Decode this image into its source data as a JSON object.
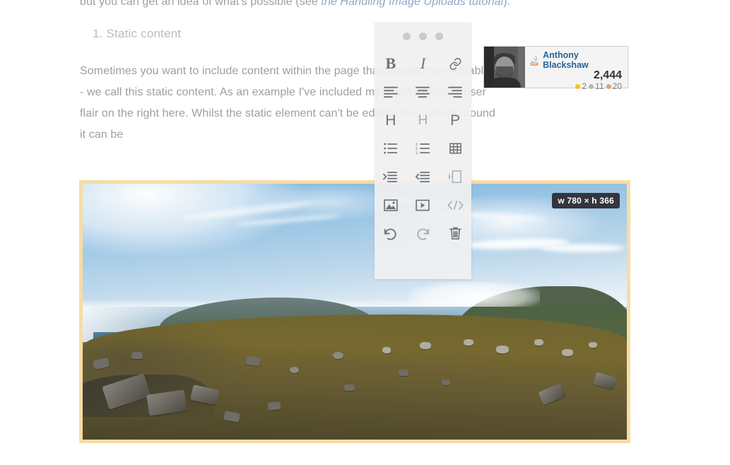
{
  "article": {
    "lead_line_prefix": "but you can get an idea of what's possible (see ",
    "lead_line_link": "the Handling Image Uploads tutorial",
    "lead_line_suffix": ").",
    "heading": "1. Static content",
    "paragraph_part1": "Sometimes you want to include content within the page that shouldn't be editable - we call this static content. As an example I've included my ",
    "paragraph_italic": "Stack Overflow",
    "paragraph_part2": " user flair on the right here. Whilst the static element can't be edited, the content around it can be",
    "trailing_dot": "."
  },
  "toolbar": {
    "drag_handle_dots": 3,
    "buttons": [
      {
        "name": "bold",
        "label": "B"
      },
      {
        "name": "italic",
        "label": "I"
      },
      {
        "name": "link",
        "label": "link"
      },
      {
        "name": "align-left",
        "label": "align left"
      },
      {
        "name": "align-center",
        "label": "align center"
      },
      {
        "name": "align-right",
        "label": "align right"
      },
      {
        "name": "heading-1",
        "label": "H"
      },
      {
        "name": "heading-2",
        "label": "H"
      },
      {
        "name": "paragraph",
        "label": "P"
      },
      {
        "name": "bullet-list",
        "label": "bullet list"
      },
      {
        "name": "numbered-list",
        "label": "numbered list"
      },
      {
        "name": "table",
        "label": "table"
      },
      {
        "name": "indent",
        "label": "indent"
      },
      {
        "name": "outdent",
        "label": "outdent"
      },
      {
        "name": "page-break",
        "label": "page break"
      },
      {
        "name": "insert-image",
        "label": "image"
      },
      {
        "name": "insert-video",
        "label": "video"
      },
      {
        "name": "source-code",
        "label": "code"
      },
      {
        "name": "undo",
        "label": "undo"
      },
      {
        "name": "redo",
        "label": "redo"
      },
      {
        "name": "delete",
        "label": "delete"
      }
    ]
  },
  "flair": {
    "site_icon": "stack-overflow-icon",
    "username": "Anthony Blackshaw",
    "reputation": "2,444",
    "badges": {
      "gold_count": "2",
      "silver_count": "11",
      "bronze_count": "20",
      "gold_color": "#fcc21b",
      "silver_color": "#b4b8bc",
      "bronze_color": "#d1a684"
    },
    "link_color": "#2a6496"
  },
  "image_block": {
    "size_badge": "w 780 × h 366",
    "frame_color": "#f7dca6",
    "alt": "Panoramic coastal landscape with rocky grassy hillside, beach, bay and headlands"
  }
}
